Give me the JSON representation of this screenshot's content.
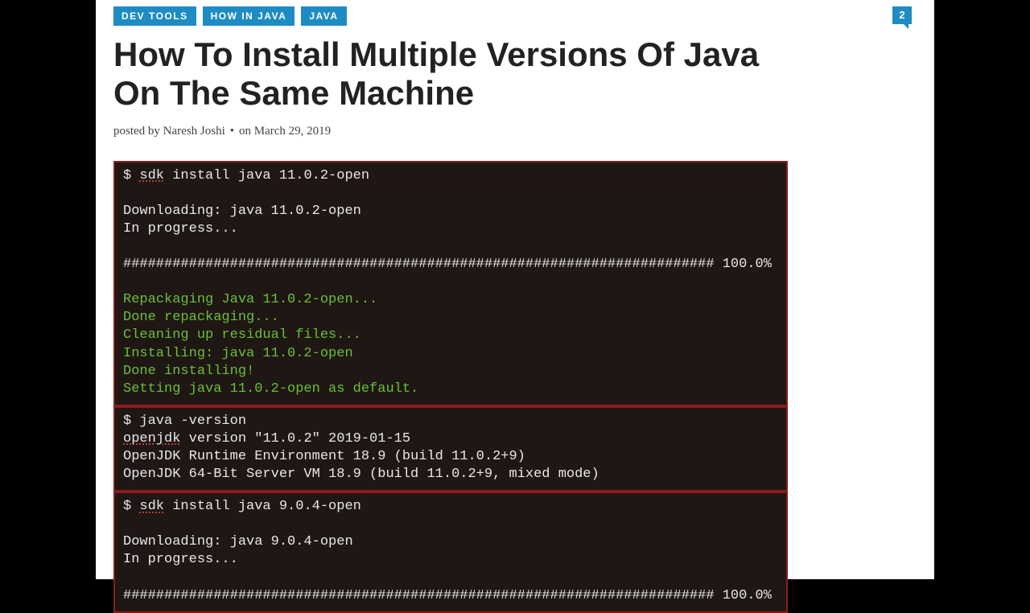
{
  "categories": [
    "DEV TOOLS",
    "HOW IN JAVA",
    "JAVA"
  ],
  "title": "How To Install Multiple Versions Of Java On The Same Machine",
  "meta": {
    "posted_by_prefix": "posted by ",
    "author": "Naresh Joshi",
    "on_prefix": "on ",
    "date": "March 29, 2019"
  },
  "comment_count": "2",
  "terminal": {
    "block1": {
      "cmd_prefix": "$ ",
      "cmd_kw": "sdk",
      "cmd_rest": " install java 11.0.2-open",
      "out1": "Downloading: java 11.0.2-open",
      "out2": "In progress...",
      "progress": "######################################################################## 100.0%",
      "g1": "Repackaging Java 11.0.2-open...",
      "g2": "Done repackaging...",
      "g3": "Cleaning up residual files...",
      "g4": "Installing: java 11.0.2-open",
      "g5": "Done installing!",
      "g6": "Setting java 11.0.2-open as default."
    },
    "block2": {
      "cmd": "$ java -version",
      "l1_a": "openjdk",
      "l1_b": " version \"11.0.2\" 2019-01-15",
      "l2": "OpenJDK Runtime Environment 18.9 (build 11.0.2+9)",
      "l3": "OpenJDK 64-Bit Server VM 18.9 (build 11.0.2+9, mixed mode)"
    },
    "block3": {
      "cmd_prefix": "$ ",
      "cmd_kw": "sdk",
      "cmd_rest": " install java 9.0.4-open",
      "out1": "Downloading: java 9.0.4-open",
      "out2": "In progress...",
      "progress": "######################################################################## 100.0%"
    }
  }
}
